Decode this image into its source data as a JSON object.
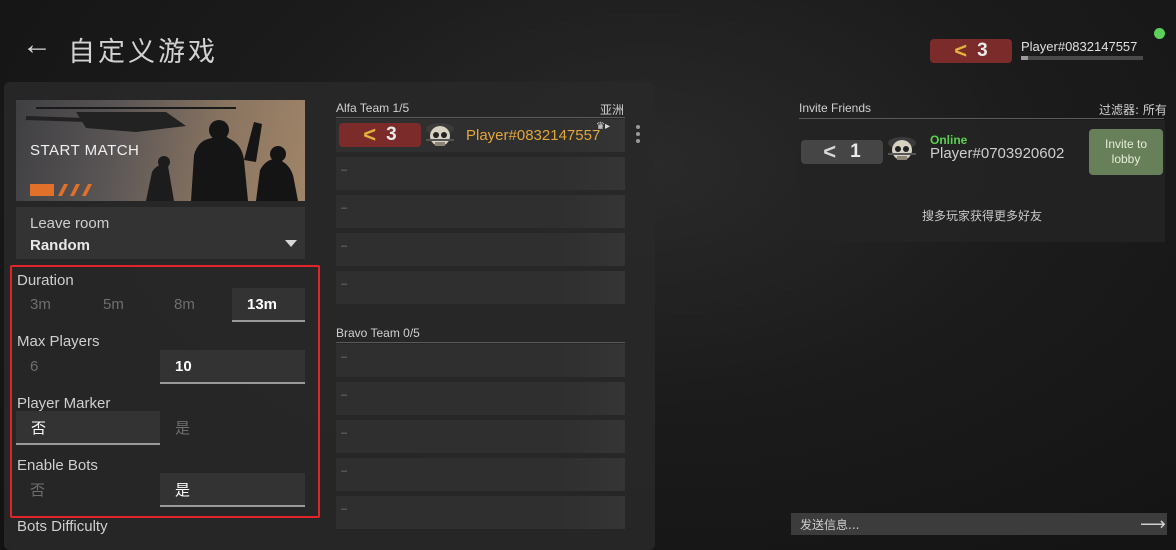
{
  "header": {
    "back_icon": "arrow-left-icon",
    "title": "自定义游戏",
    "player_rank": "3",
    "player_name": "Player#0832147557",
    "status_color": "#5bd15b"
  },
  "left": {
    "start_match": "START MATCH",
    "leave_room": "Leave room",
    "map_value": "Random",
    "settings": {
      "duration": {
        "label": "Duration",
        "options": [
          "3m",
          "5m",
          "8m",
          "13m"
        ],
        "selected": "13m"
      },
      "max_players": {
        "label": "Max Players",
        "options": [
          "6",
          "10"
        ],
        "selected": "10"
      },
      "player_marker": {
        "label": "Player Marker",
        "options": [
          "否",
          "是"
        ],
        "selected": "否"
      },
      "enable_bots": {
        "label": "Enable Bots",
        "options": [
          "否",
          "是"
        ],
        "selected": "是"
      },
      "bots_difficulty": {
        "label": "Bots Difficulty"
      }
    }
  },
  "teams": {
    "alfa": {
      "title": "Alfa Team 1/5",
      "region": "亚洲",
      "player": {
        "rank": "3",
        "name": "Player#0832147557"
      },
      "empty_slot": "–"
    },
    "bravo": {
      "title": "Bravo Team 0/5",
      "empty_slot": "–"
    }
  },
  "friends": {
    "title": "Invite Friends",
    "filter": "过滤器: 所有",
    "friend": {
      "rank": "1",
      "status": "Online",
      "name": "Player#0703920602",
      "invite_label": "Invite to lobby"
    },
    "more_friends": "搜多玩家获得更多好友"
  },
  "chat": {
    "placeholder": "发送信息..."
  },
  "colors": {
    "rank_badge": "#7c2b2b",
    "rank_chevron": "#e3b33a",
    "player_name_highlight": "#e3a63a",
    "online": "#59d14f",
    "invite_button": "#68805a",
    "settings_outline": "#e0242a"
  }
}
